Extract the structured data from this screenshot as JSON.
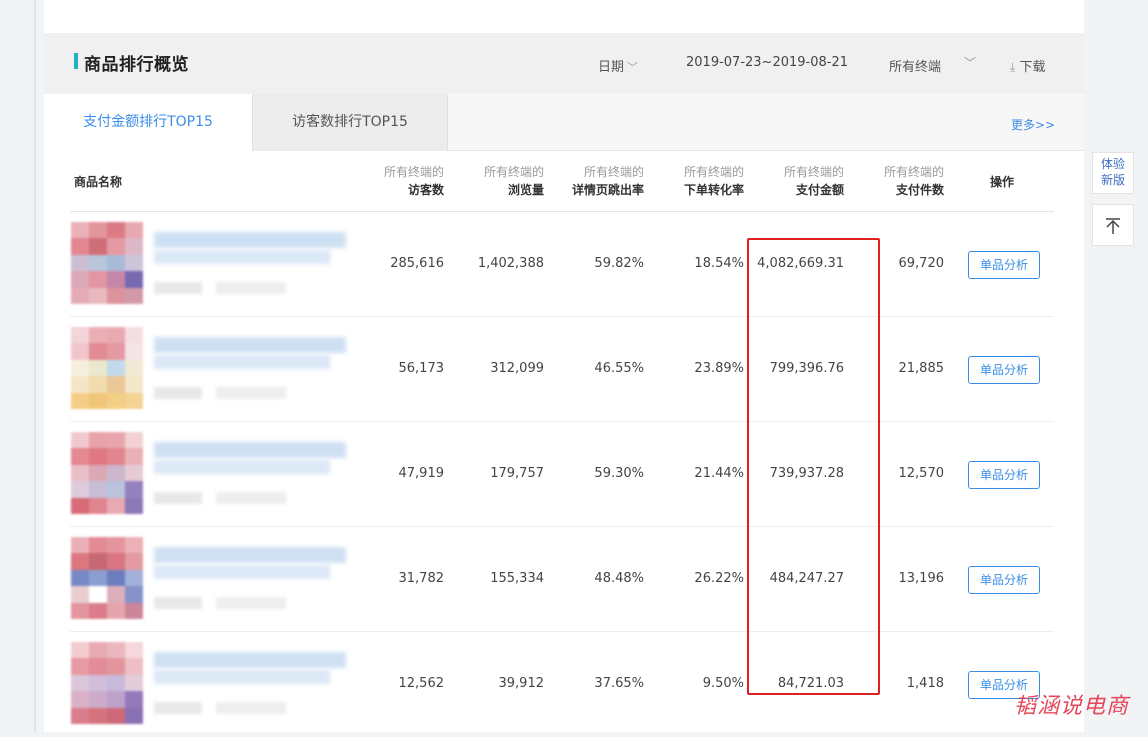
{
  "panel": {
    "title": "商品排行概览",
    "date_label": "日期",
    "date_range": "2019-07-23~2019-08-21",
    "terminal_label": "所有终端",
    "download_label": "下载"
  },
  "tabs": [
    {
      "label": "支付金额排行TOP15",
      "active": true
    },
    {
      "label": "访客数排行TOP15",
      "active": false
    }
  ],
  "more_link": "更多>>",
  "table": {
    "columns": {
      "name": "商品名称",
      "visitors": {
        "sub": "所有终端的",
        "main": "访客数"
      },
      "pageviews": {
        "sub": "所有终端的",
        "main": "浏览量"
      },
      "bounce": {
        "sub": "所有终端的",
        "main": "详情页跳出率"
      },
      "conversion": {
        "sub": "所有终端的",
        "main": "下单转化率"
      },
      "amount": {
        "sub": "所有终端的",
        "main": "支付金额"
      },
      "items": {
        "sub": "所有终端的",
        "main": "支付件数"
      },
      "op": "操作"
    },
    "rows": [
      {
        "visitors": "285,616",
        "pageviews": "1,402,388",
        "bounce": "59.82%",
        "conversion": "18.54%",
        "amount": "4,082,669.31",
        "items": "69,720",
        "action": "单品分析"
      },
      {
        "visitors": "56,173",
        "pageviews": "312,099",
        "bounce": "46.55%",
        "conversion": "23.89%",
        "amount": "799,396.76",
        "items": "21,885",
        "action": "单品分析"
      },
      {
        "visitors": "47,919",
        "pageviews": "179,757",
        "bounce": "59.30%",
        "conversion": "21.44%",
        "amount": "739,937.28",
        "items": "12,570",
        "action": "单品分析"
      },
      {
        "visitors": "31,782",
        "pageviews": "155,334",
        "bounce": "48.48%",
        "conversion": "26.22%",
        "amount": "484,247.27",
        "items": "13,196",
        "action": "单品分析"
      },
      {
        "visitors": "12,562",
        "pageviews": "39,912",
        "bounce": "37.65%",
        "conversion": "9.50%",
        "amount": "84,721.03",
        "items": "1,418",
        "action": "单品分析"
      }
    ]
  },
  "side": {
    "new_version_line1": "体验",
    "new_version_line2": "新版",
    "back_to_top_icon": "arrow-up-to-top-icon"
  },
  "watermark": "韬涵说电商",
  "colors": {
    "accent": "#3a8ee6",
    "title_bar": "#25b0c1",
    "highlight": "#e02020"
  }
}
